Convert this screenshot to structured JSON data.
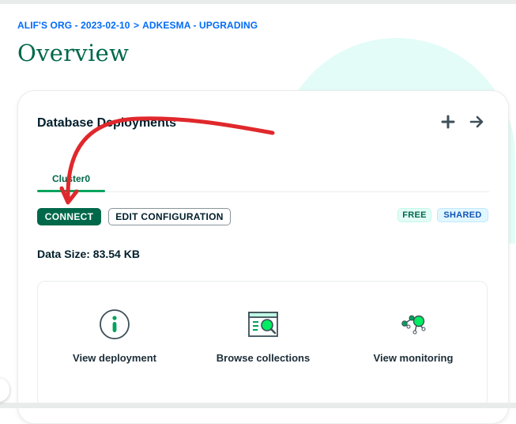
{
  "breadcrumb": {
    "org": "ALIF'S ORG",
    "project": "2023-02-10",
    "separator": ">",
    "cluster_path": "ADKESMA - UPGRADING"
  },
  "page": {
    "title": "Overview"
  },
  "card": {
    "title": "Database Deployments",
    "add_icon": "plus-icon",
    "go_icon": "arrow-right-icon",
    "tabs": [
      {
        "label": "Cluster0",
        "active": true
      }
    ],
    "connect_label": "CONNECT",
    "edit_label": "EDIT CONFIGURATION",
    "badges": {
      "free": "FREE",
      "shared": "SHARED"
    },
    "data_size": "Data Size: 83.54 KB",
    "actions": [
      {
        "label": "View deployment",
        "icon": "info-circle-icon"
      },
      {
        "label": "Browse collections",
        "icon": "browse-collections-icon"
      },
      {
        "label": "View monitoring",
        "icon": "monitoring-icon"
      }
    ]
  },
  "annotation": {
    "type": "red-curved-arrow",
    "points_to": "connect-button",
    "color": "#e0282c"
  },
  "colors": {
    "brand_green": "#00684a",
    "link_blue": "#016bf8",
    "accent_green": "#00ed64",
    "text_dark": "#001e2b"
  }
}
